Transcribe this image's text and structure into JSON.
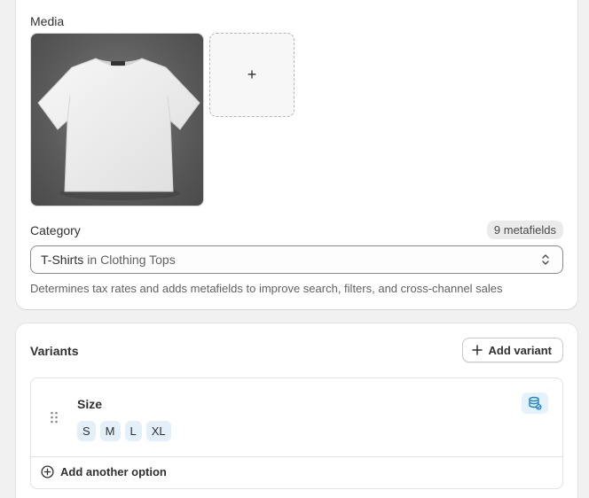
{
  "media": {
    "label": "Media",
    "add_symbol": "+"
  },
  "category": {
    "label": "Category",
    "metafields_badge": "9 metafields",
    "selected_main": "T-Shirts",
    "selected_sep": "in",
    "selected_sub": "Clothing Tops",
    "help_text": "Determines tax rates and adds metafields to improve search, filters, and cross-channel sales"
  },
  "variants": {
    "title": "Variants",
    "add_variant_label": "Add variant",
    "option": {
      "name": "Size",
      "values": [
        "S",
        "M",
        "L",
        "XL"
      ]
    },
    "add_option_label": "Add another option"
  },
  "colors": {
    "accent_chip": "#e4f0f9",
    "icon_blue": "#1f86c7"
  },
  "icons": {
    "add_variant": "plus-icon",
    "add_option": "plus-circle-icon",
    "drag": "drag-handle-icon",
    "option_action": "database-icon",
    "select": "chevron-up-down-icon"
  }
}
